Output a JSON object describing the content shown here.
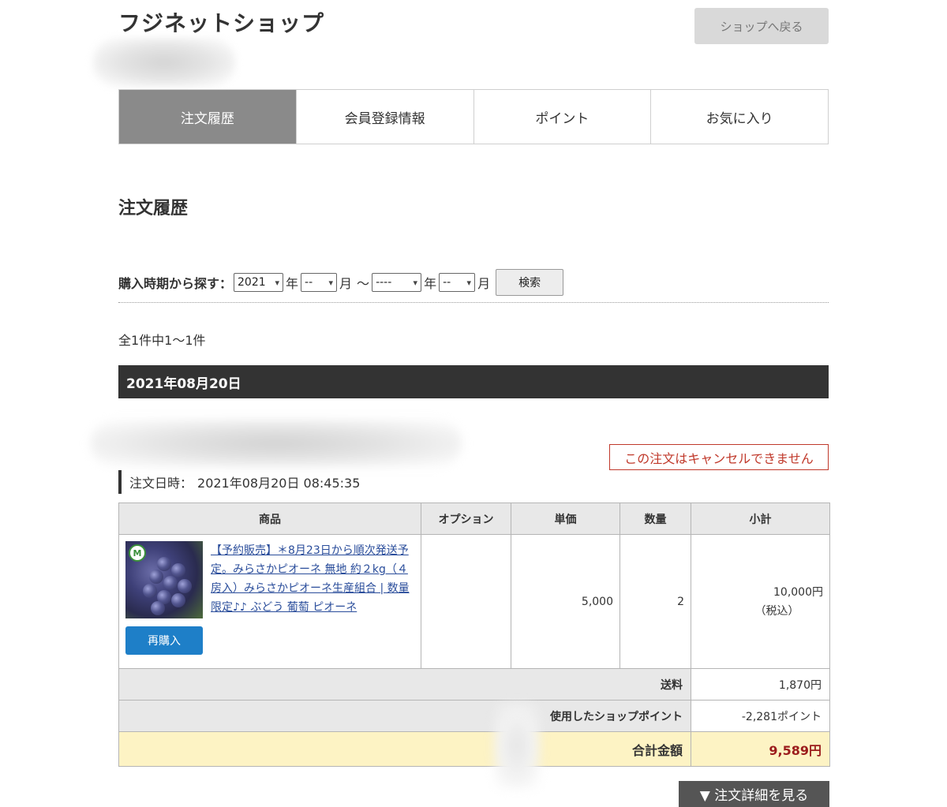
{
  "header": {
    "shop_title": "フジネットショップ",
    "back_button": "ショップへ戻る"
  },
  "tabs": [
    {
      "label": "注文履歴",
      "active": true
    },
    {
      "label": "会員登録情報",
      "active": false
    },
    {
      "label": "ポイント",
      "active": false
    },
    {
      "label": "お気に入り",
      "active": false
    }
  ],
  "page_title": "注文履歴",
  "search": {
    "label": "購入時期から探す：",
    "from_year": "2021",
    "year_unit": "年",
    "from_month": "--",
    "month_unit": "月",
    "range_sep": "〜",
    "to_year": "----",
    "to_month": "--",
    "button": "検索"
  },
  "result_count": "全1件中1〜1件",
  "order": {
    "date": "2021年08月20日",
    "cancel_note": "この注文はキャンセルできません",
    "order_time_label": "注文日時：",
    "order_time": "2021年08月20日 08:45:35",
    "columns": [
      "商品",
      "オプション",
      "単価",
      "数量",
      "小計"
    ],
    "item": {
      "name": "【予約販売】＊8月23日から順次発送予定。みらさかピオーネ 無地 約２kg（４房入）みらさかピオーネ生産組合 | 数量限定♪♪ ぶどう 葡萄 ピオーネ",
      "image_icon": "grape-product-image",
      "logo_letter": "M",
      "rebuy_button": "再購入",
      "option": "",
      "unit_price": "5,000",
      "quantity": "2",
      "subtotal": "10,000円",
      "tax_note": "（税込）"
    },
    "shipping_label": "送料",
    "shipping": "1,870円",
    "points_label": "使用したショップポイント",
    "points_used": "-2,281ポイント",
    "total_label": "合計金額",
    "total": "9,589円"
  },
  "detail_button": "▼ 注文詳細を見る",
  "colors": {
    "active_tab": "#8a8a8a",
    "date_bar": "#333333",
    "cancel_red": "#c0392b",
    "rebuy_blue": "#1e7fc8",
    "total_bg": "#fdf3c4",
    "total_text": "#9b1c1c"
  }
}
